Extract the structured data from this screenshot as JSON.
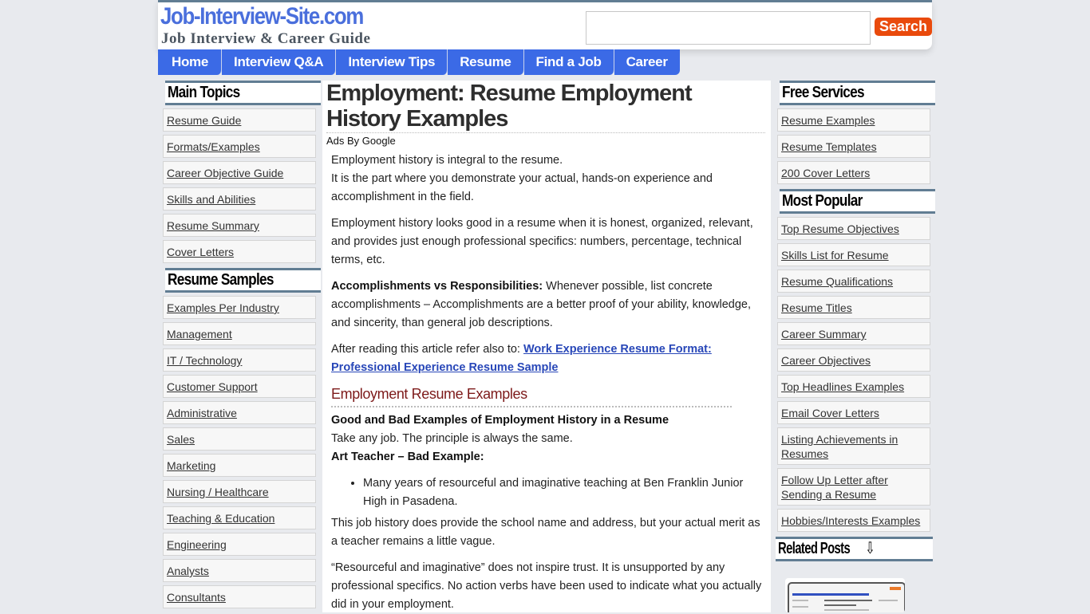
{
  "site": {
    "logo": "Job-Interview-Site.com",
    "tagline": "Job Interview & Career Guide"
  },
  "search": {
    "value": "",
    "placeholder": "",
    "button_label": "Search"
  },
  "nav": [
    {
      "label": "Home"
    },
    {
      "label": "Interview Q&A"
    },
    {
      "label": "Interview Tips"
    },
    {
      "label": "Resume"
    },
    {
      "label": "Find a Job"
    },
    {
      "label": "Career"
    }
  ],
  "left_sidebar": {
    "main_topics": {
      "title": "Main Topics",
      "items": [
        "Resume Guide",
        "Formats/Examples",
        "Career Objective Guide",
        "Skills and Abilities",
        "Resume Summary",
        "Cover Letters"
      ]
    },
    "resume_samples": {
      "title": "Resume Samples",
      "items": [
        "Examples Per Industry",
        "Management",
        "IT / Technology",
        "Customer Support",
        "Administrative",
        "Sales",
        "Marketing",
        "Nursing / Healthcare",
        "Teaching & Education",
        "Engineering",
        "Analysts",
        "Consultants"
      ]
    }
  },
  "right_sidebar": {
    "free_services": {
      "title": "Free Services",
      "items": [
        "Resume Examples",
        "Resume Templates",
        "200 Cover Letters"
      ]
    },
    "most_popular": {
      "title": "Most Popular",
      "items": [
        "Top Resume Objectives",
        "Skills List for Resume",
        "Resume Qualifications",
        "Resume Titles",
        "Career Summary",
        "Career Objectives",
        "Top Headlines Examples",
        "Email Cover Letters",
        "Listing Achievements in Resumes",
        "Follow Up Letter after Sending a Resume",
        "Hobbies/Interests Examples"
      ]
    },
    "related_posts": {
      "title": "Related Posts",
      "icon": "down-arrow-icon",
      "icon_glyph": "⇩"
    }
  },
  "article": {
    "title": "Employment: Resume Employment History Examples",
    "ads_label": "Ads By Google",
    "p1_line1": "Employment history is integral to the resume.",
    "p1_line2": "It is the part where you demonstrate your actual, hands-on experience and accomplishment in the field.",
    "p2": "Employment history looks good in a resume when it is honest, organized, relevant, and provides just enough professional specifics: numbers, percentage, technical terms, etc.",
    "p3_bold": "Accomplishments vs Responsibilities:",
    "p3_text": " Whenever possible, list concrete accomplishments – Accomplishments are a better proof of your ability, knowledge, and sincerity, than general job descriptions.",
    "p4_text": "After reading this article refer also to: ",
    "p4_link1": "Work Experience Resume Format:",
    "p4_link2": "Professional Experience Resume Sample",
    "subheading": "Employment Resume Examples",
    "p5_bold": "Good and Bad Examples of Employment History in a Resume",
    "p5_text": "Take any job. The principle is always the same.",
    "p5_bold2": "Art Teacher – Bad Example:",
    "bullets": [
      "Many years of resourceful and imaginative teaching at Ben Franklin Junior High in Pasadena."
    ],
    "p6": "This job history does provide the school name and address, but your actual merit as a teacher remains a little vague.",
    "p7": "“Resourceful and imaginative” does not inspire trust. It is unsupported by any professional specifics. No action verbs have been used to indicate what you actually did in your employment."
  }
}
